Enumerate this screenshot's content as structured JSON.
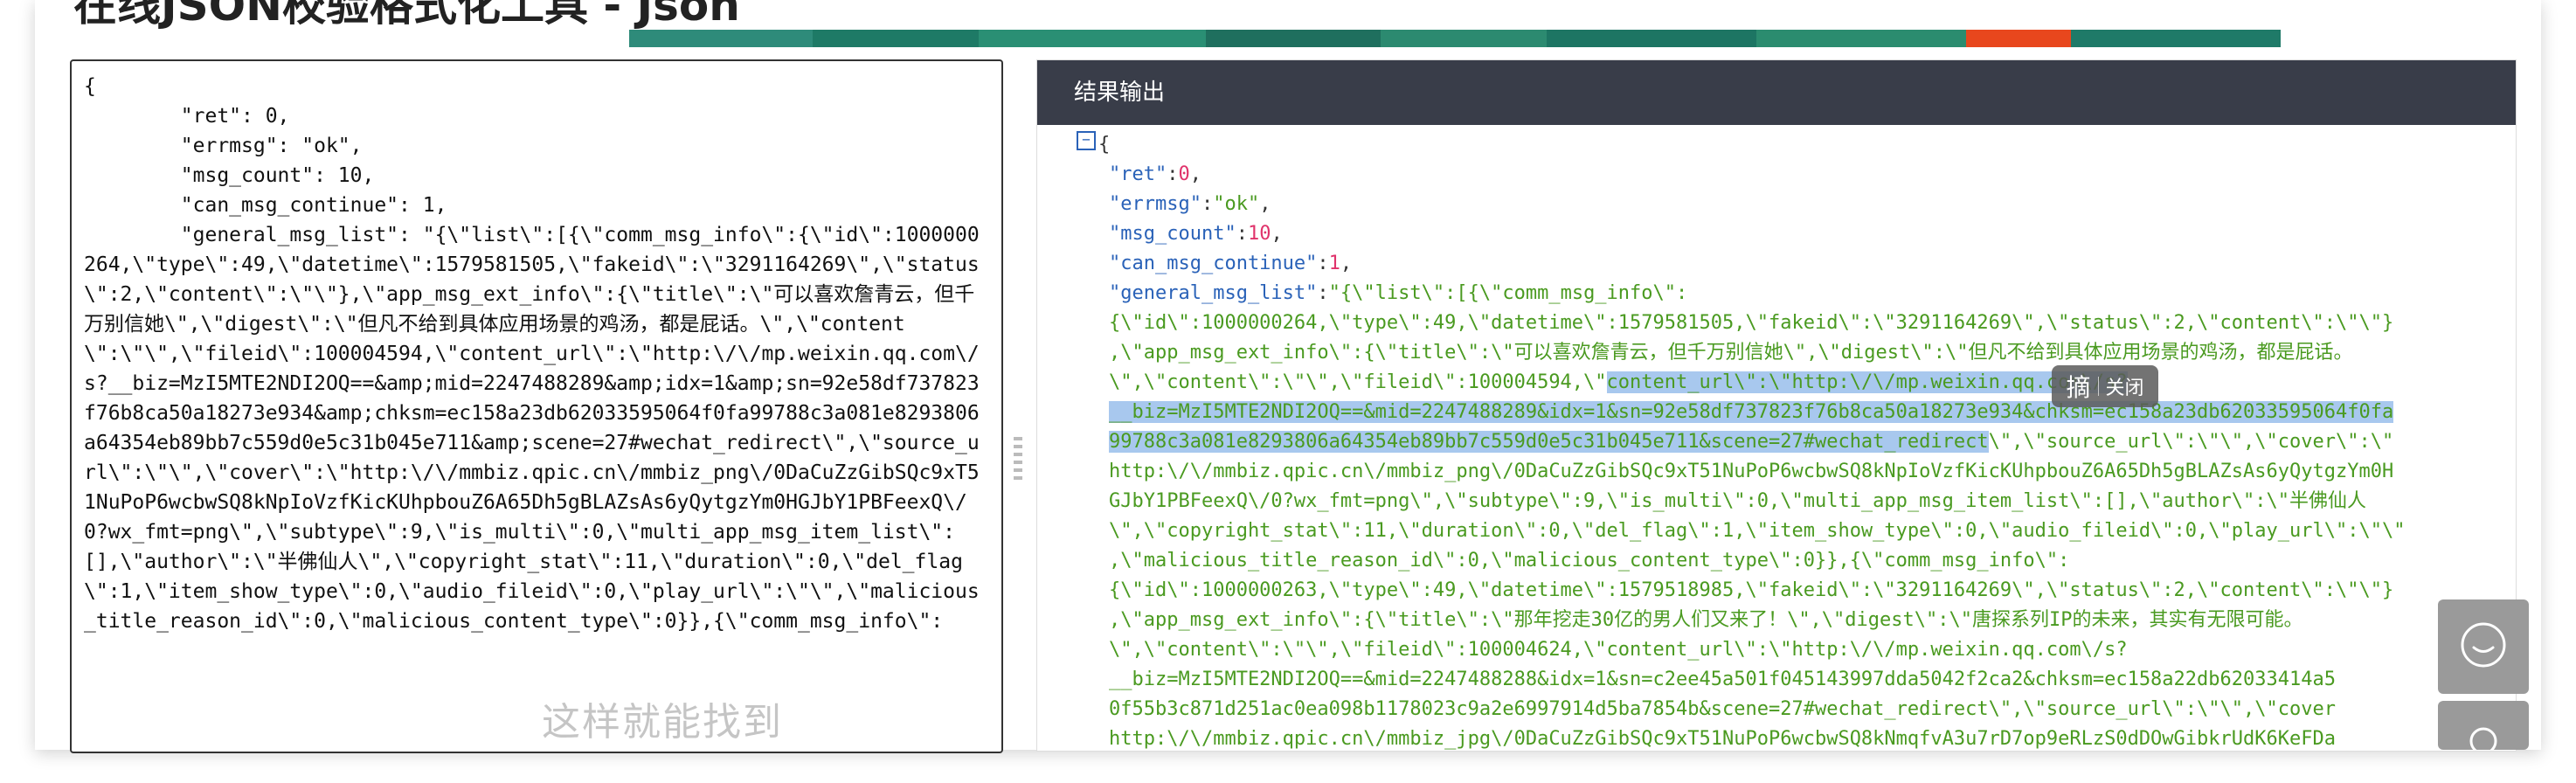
{
  "page_title": "在线JSON校验格式化工具 - Json",
  "strip_colors": [
    "#2e8b7a",
    "#1e7a66",
    "#2a8f74",
    "#1f6f5e",
    "#2c8a70",
    "#1d7563",
    "#2b8c6f",
    "#e8471d",
    "#1f7a68"
  ],
  "left_editor": {
    "text": "{\n        \"ret\": 0,\n        \"errmsg\": \"ok\",\n        \"msg_count\": 10,\n        \"can_msg_continue\": 1,\n        \"general_msg_list\": \"{\\\"list\\\":[{\\\"comm_msg_info\\\":{\\\"id\\\":1000000264,\\\"type\\\":49,\\\"datetime\\\":1579581505,\\\"fakeid\\\":\\\"3291164269\\\",\\\"status\\\":2,\\\"content\\\":\\\"\\\"},\\\"app_msg_ext_info\\\":{\\\"title\\\":\\\"可以喜欢詹青云，但千万别信她\\\",\\\"digest\\\":\\\"但凡不给到具体应用场景的鸡汤，都是屁话。\\\",\\\"content\\\":\\\"\\\",\\\"fileid\\\":100004594,\\\"content_url\\\":\\\"http:\\/\\/mp.weixin.qq.com\\/s?__biz=MzI5MTE2NDI2OQ==&amp;mid=2247488289&amp;idx=1&amp;sn=92e58df737823f76b8ca50a18273e934&amp;chksm=ec158a23db62033595064f0fa99788c3a081e8293806a64354eb89bb7c559d0e5c31b045e711&amp;scene=27#wechat_redirect\\\",\\\"source_url\\\":\\\"\\\",\\\"cover\\\":\\\"http:\\/\\/mmbiz.qpic.cn\\/mmbiz_png\\/0DaCuZzGibSQc9xT51NuPoP6wcbwSQ8kNpIoVzfKicKUhpbouZ6A65Dh5gBLAZsAs6yQytgzYm0HGJbY1PBFeexQ\\/0?wx_fmt=png\\\",\\\"subtype\\\":9,\\\"is_multi\\\":0,\\\"multi_app_msg_item_list\\\":[],\\\"author\\\":\\\"半佛仙人\\\",\\\"copyright_stat\\\":11,\\\"duration\\\":0,\\\"del_flag\\\":1,\\\"item_show_type\\\":0,\\\"audio_fileid\\\":0,\\\"play_url\\\":\\\"\\\",\\\"malicious_title_reason_id\\\":0,\\\"malicious_content_type\\\":0}},{\\\"comm_msg_info\\\":"
  },
  "watermark": "这样就能找到",
  "result_panel": {
    "header": "结果输出",
    "collapse_symbol": "−",
    "lines": [
      [
        {
          "c": "p",
          "t": "{"
        }
      ],
      [
        {
          "c": "k",
          "t": "\"ret\""
        },
        {
          "c": "p",
          "t": ":"
        },
        {
          "c": "n",
          "t": "0"
        },
        {
          "c": "p",
          "t": ","
        }
      ],
      [
        {
          "c": "k",
          "t": "\"errmsg\""
        },
        {
          "c": "p",
          "t": ":"
        },
        {
          "c": "s",
          "t": "\"ok\""
        },
        {
          "c": "p",
          "t": ","
        }
      ],
      [
        {
          "c": "k",
          "t": "\"msg_count\""
        },
        {
          "c": "p",
          "t": ":"
        },
        {
          "c": "n",
          "t": "10"
        },
        {
          "c": "p",
          "t": ","
        }
      ],
      [
        {
          "c": "k",
          "t": "\"can_msg_continue\""
        },
        {
          "c": "p",
          "t": ":"
        },
        {
          "c": "n",
          "t": "1"
        },
        {
          "c": "p",
          "t": ","
        }
      ],
      [
        {
          "c": "k",
          "t": "\"general_msg_list\""
        },
        {
          "c": "p",
          "t": ":"
        },
        {
          "c": "s",
          "t": "\"{\\\"list\\\":[{\\\"comm_msg_info\\\":"
        }
      ],
      [
        {
          "c": "s",
          "t": "{\\\"id\\\":1000000264,\\\"type\\\":49,\\\"datetime\\\":1579581505,\\\"fakeid\\\":\\\"3291164269\\\",\\\"status\\\":2,\\\"content\\\":\\\"\\\"}"
        }
      ],
      [
        {
          "c": "s",
          "t": ",\\\"app_msg_ext_info\\\":{\\\"title\\\":\\\"可以喜欢詹青云，但千万别信她\\\",\\\"digest\\\":\\\"但凡不给到具体应用场景的鸡汤，都是屁话。"
        }
      ],
      [
        {
          "c": "s",
          "t": "\\\",\\\"content\\\":\\\"\\\",\\\"fileid\\\":100004594,\\\""
        },
        {
          "c": "hl",
          "t": "content_url\\\":\\\"http:\\/\\/mp.weixin.qq.com\\/s?"
        }
      ],
      [
        {
          "c": "hl",
          "t": "__biz=MzI5MTE2NDI2OQ==&mid=2247488289&idx=1&sn=92e58df737823f76b8ca50a18273e934&chksm=ec158a23db62033595064f0fa"
        }
      ],
      [
        {
          "c": "hl",
          "t": "99788c3a081e8293806a64354eb89bb7c559d0e5c31b045e711&scene=27#wechat_redirect"
        },
        {
          "c": "s",
          "t": "\\\",\\\"source_url\\\":\\\"\\\",\\\"cover\\\":\\\""
        }
      ],
      [
        {
          "c": "s",
          "t": "http:\\/\\/mmbiz.qpic.cn\\/mmbiz_png\\/0DaCuZzGibSQc9xT51NuPoP6wcbwSQ8kNpIoVzfKicKUhpbouZ6A65Dh5gBLAZsAs6yQytgzYm0H"
        }
      ],
      [
        {
          "c": "s",
          "t": "GJbY1PBFeexQ\\/0?wx_fmt=png\\\",\\\"subtype\\\":9,\\\"is_multi\\\":0,\\\"multi_app_msg_item_list\\\":[],\\\"author\\\":\\\"半佛仙人"
        }
      ],
      [
        {
          "c": "s",
          "t": "\\\",\\\"copyright_stat\\\":11,\\\"duration\\\":0,\\\"del_flag\\\":1,\\\"item_show_type\\\":0,\\\"audio_fileid\\\":0,\\\"play_url\\\":\\\"\\\""
        }
      ],
      [
        {
          "c": "s",
          "t": ",\\\"malicious_title_reason_id\\\":0,\\\"malicious_content_type\\\":0}},{\\\"comm_msg_info\\\":"
        }
      ],
      [
        {
          "c": "s",
          "t": "{\\\"id\\\":1000000263,\\\"type\\\":49,\\\"datetime\\\":1579518985,\\\"fakeid\\\":\\\"3291164269\\\",\\\"status\\\":2,\\\"content\\\":\\\"\\\"}"
        }
      ],
      [
        {
          "c": "s",
          "t": ",\\\"app_msg_ext_info\\\":{\\\"title\\\":\\\"那年挖走30亿的男人们又来了！\\\",\\\"digest\\\":\\\"唐探系列IP的未来，其实有无限可能。"
        }
      ],
      [
        {
          "c": "s",
          "t": "\\\",\\\"content\\\":\\\"\\\",\\\"fileid\\\":100004624,\\\"content_url\\\":\\\"http:\\/\\/mp.weixin.qq.com\\/s?"
        }
      ],
      [
        {
          "c": "s",
          "t": "__biz=MzI5MTE2NDI2OQ==&mid=2247488288&idx=1&sn=c2ee45a501f045143997dda5042f2ca2&chksm=ec158a22db62033414a5"
        }
      ],
      [
        {
          "c": "s",
          "t": "0f55b3c871d251ac0ea098b1178023c9a2e6997914d5ba7854b&scene=27#wechat_redirect\\\",\\\"source_url\\\":\\\"\\\",\\\"cover"
        }
      ],
      [
        {
          "c": "s",
          "t": "http:\\/\\/mmbiz.qpic.cn\\/mmbiz_jpg\\/0DaCuZzGibSQc9xT51NuPoP6wcbwSQ8kNmqfvA3u7rD7op9eRLzS0dDOwGibkrUdK6KeFDa"
        }
      ]
    ]
  },
  "tooltip": {
    "primary": "摘",
    "secondary": "关闭"
  },
  "side_buttons": [
    {
      "icon": "chat-bubble-icon"
    },
    {
      "icon": "user-support-icon"
    }
  ]
}
